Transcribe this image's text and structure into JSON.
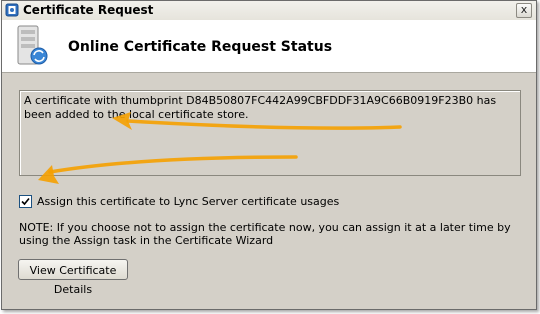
{
  "window": {
    "title": "Certificate Request",
    "close_label": "x",
    "icon": "certificate-app-icon"
  },
  "header": {
    "title": "Online Certificate Request Status",
    "icon": "certificate-server-icon"
  },
  "status": {
    "message": "A certificate with thumbprint D84B50807FC442A99CBFDDF31A9C66B0919F23B0 has been added to the local certificate store."
  },
  "assign": {
    "label": "Assign this certificate to Lync Server certificate usages",
    "checked": true
  },
  "note": {
    "text": "NOTE: If you choose not to assign the certificate now, you can assign it at a later time by using the Assign task in the Certificate Wizard"
  },
  "buttons": {
    "view_details": "View Certificate Details"
  },
  "colors": {
    "annotation_arrow": "#f5a000",
    "dialog_bg": "#d4d0c8",
    "header_bg": "#ffffff"
  }
}
